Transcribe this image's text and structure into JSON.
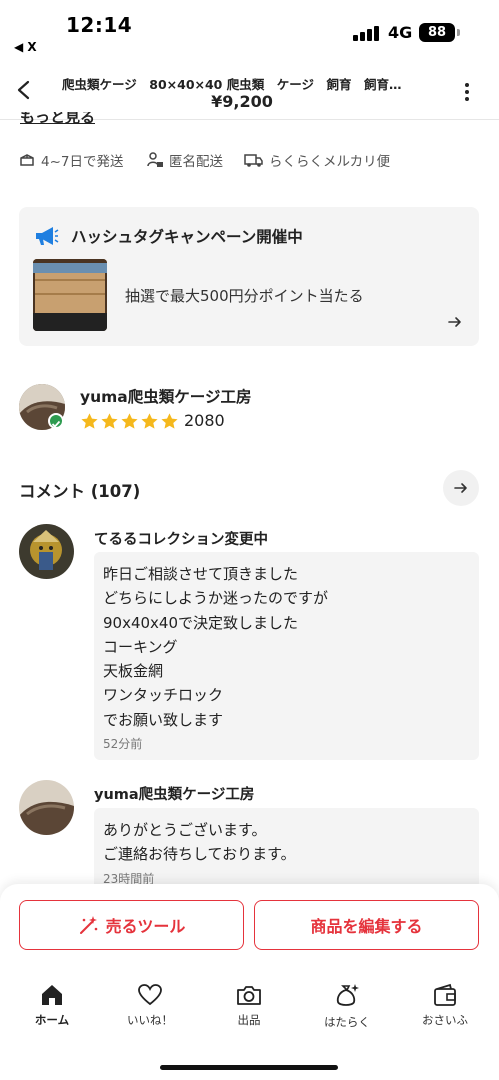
{
  "status_bar": {
    "time": "12:14",
    "back_app": "◀ X",
    "network": "4G",
    "battery": "88"
  },
  "header": {
    "title": "爬虫類ケージ　80×40×40 爬虫類　ケージ　飼育　飼育…",
    "price": "¥9,200"
  },
  "see_more": "もっと見る",
  "shipping": {
    "days": "4~7日で発送",
    "anonymous": "匿名配送",
    "method": "らくらくメルカリ便"
  },
  "campaign": {
    "title": "ハッシュタグキャンペーン開催中",
    "text": "抽選で最大500円分ポイント当たる"
  },
  "seller": {
    "name": "yuma爬虫類ケージ工房",
    "rating": 5,
    "rating_count": "2080"
  },
  "comments": {
    "title": "コメント (107)",
    "items": [
      {
        "name": "てるるコレクション変更中",
        "lines": [
          "昨日ご相談させて頂きました",
          "どちらにしようか迷ったのですが",
          "90x40x40で決定致しました",
          "コーキング",
          "天板金網",
          "ワンタッチロック",
          "でお願い致します"
        ],
        "time": "52分前"
      },
      {
        "name": "yuma爬虫類ケージ工房",
        "lines": [
          "ありがとうございます。",
          "ご連絡お待ちしております。"
        ],
        "time": "23時間前"
      }
    ]
  },
  "actions": {
    "sell_tool": "売るツール",
    "edit_item": "商品を編集する"
  },
  "tabs": [
    {
      "label": "ホーム",
      "icon": "home-icon"
    },
    {
      "label": "いいね！",
      "icon": "heart-icon"
    },
    {
      "label": "出品",
      "icon": "camera-icon"
    },
    {
      "label": "はたらく",
      "icon": "money-bag-icon"
    },
    {
      "label": "おさいふ",
      "icon": "wallet-icon"
    }
  ],
  "colors": {
    "accent": "#e5333c",
    "star": "#f5b81c",
    "campaign_icon": "#1f7fe0",
    "verified": "#2e9b50"
  }
}
